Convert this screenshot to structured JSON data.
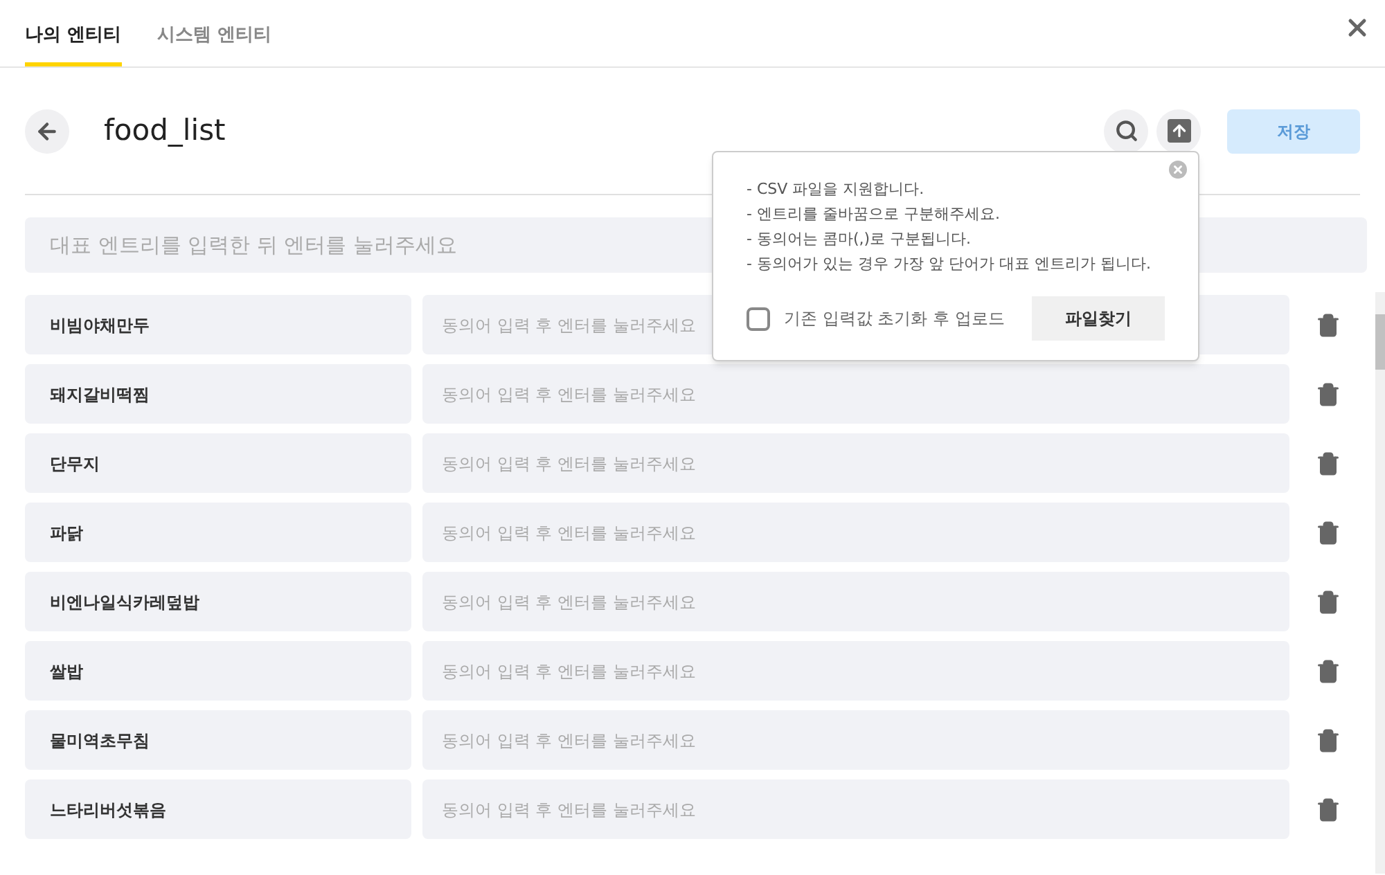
{
  "tabs": [
    {
      "label": "나의 엔티티",
      "selected": true
    },
    {
      "label": "시스템 엔티티",
      "selected": false
    }
  ],
  "header": {
    "title": "food_list",
    "save_button": "저장",
    "save_disabled": true
  },
  "entry_input": {
    "placeholder": "대표 엔트리를 입력한 뒤 엔터를 눌러주세요"
  },
  "entries": [
    {
      "name": "비빔야채만두",
      "synonym_placeholder": "동의어 입력 후 엔터를 눌러주세요"
    },
    {
      "name": "돼지갈비떡찜",
      "synonym_placeholder": "동의어 입력 후 엔터를 눌러주세요"
    },
    {
      "name": "단무지",
      "synonym_placeholder": "동의어 입력 후 엔터를 눌러주세요"
    },
    {
      "name": "파닭",
      "synonym_placeholder": "동의어 입력 후 엔터를 눌러주세요"
    },
    {
      "name": "비엔나일식카레덮밥",
      "synonym_placeholder": "동의어 입력 후 엔터를 눌러주세요"
    },
    {
      "name": "쌀밥",
      "synonym_placeholder": "동의어 입력 후 엔터를 눌러주세요"
    },
    {
      "name": "물미역초무침",
      "synonym_placeholder": "동의어 입력 후 엔터를 눌러주세요"
    },
    {
      "name": "느타리버섯볶음",
      "synonym_placeholder": "동의어 입력 후 엔터를 눌러주세요"
    }
  ],
  "upload_popover": {
    "notes": [
      "- CSV 파일을 지원합니다.",
      "- 엔트리를 줄바꿈으로 구분해주세요.",
      "- 동의어는 콤마(,)로 구분됩니다.",
      "- 동의어가 있는 경우 가장 앞 단어가 대표 엔트리가 됩니다."
    ],
    "reset_option": {
      "label": "기존 입력값 초기화 후 업로드",
      "checked": false
    },
    "browse_button": "파일찾기"
  }
}
